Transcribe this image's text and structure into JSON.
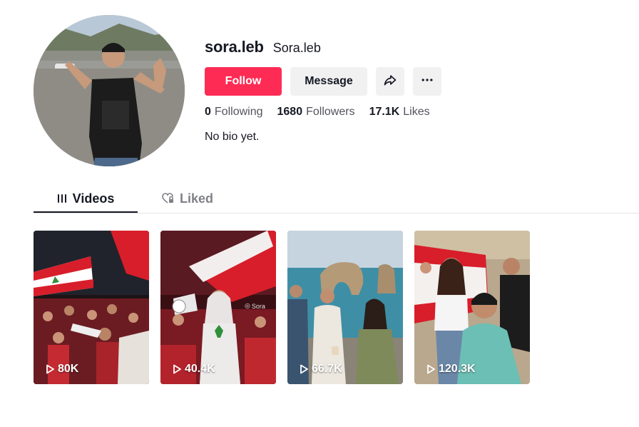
{
  "profile": {
    "username": "sora.leb",
    "nickname": "Sora.leb",
    "bio": "No bio yet."
  },
  "actions": {
    "follow_label": "Follow",
    "message_label": "Message",
    "share_icon": "share-icon",
    "more_icon": "more-icon"
  },
  "stats": {
    "following_count": "0",
    "following_label": "Following",
    "followers_count": "1680",
    "followers_label": "Followers",
    "likes_count": "17.1K",
    "likes_label": "Likes"
  },
  "tabs": {
    "videos_label": "Videos",
    "liked_label": "Liked",
    "active": "videos"
  },
  "videos": [
    {
      "views": "80K"
    },
    {
      "views": "40.4K",
      "watermark": "Sora"
    },
    {
      "views": "66.7K"
    },
    {
      "views": "120.3K"
    }
  ],
  "colors": {
    "accent": "#fe2c55",
    "button_bg": "#f1f1f2",
    "text": "#161823"
  }
}
